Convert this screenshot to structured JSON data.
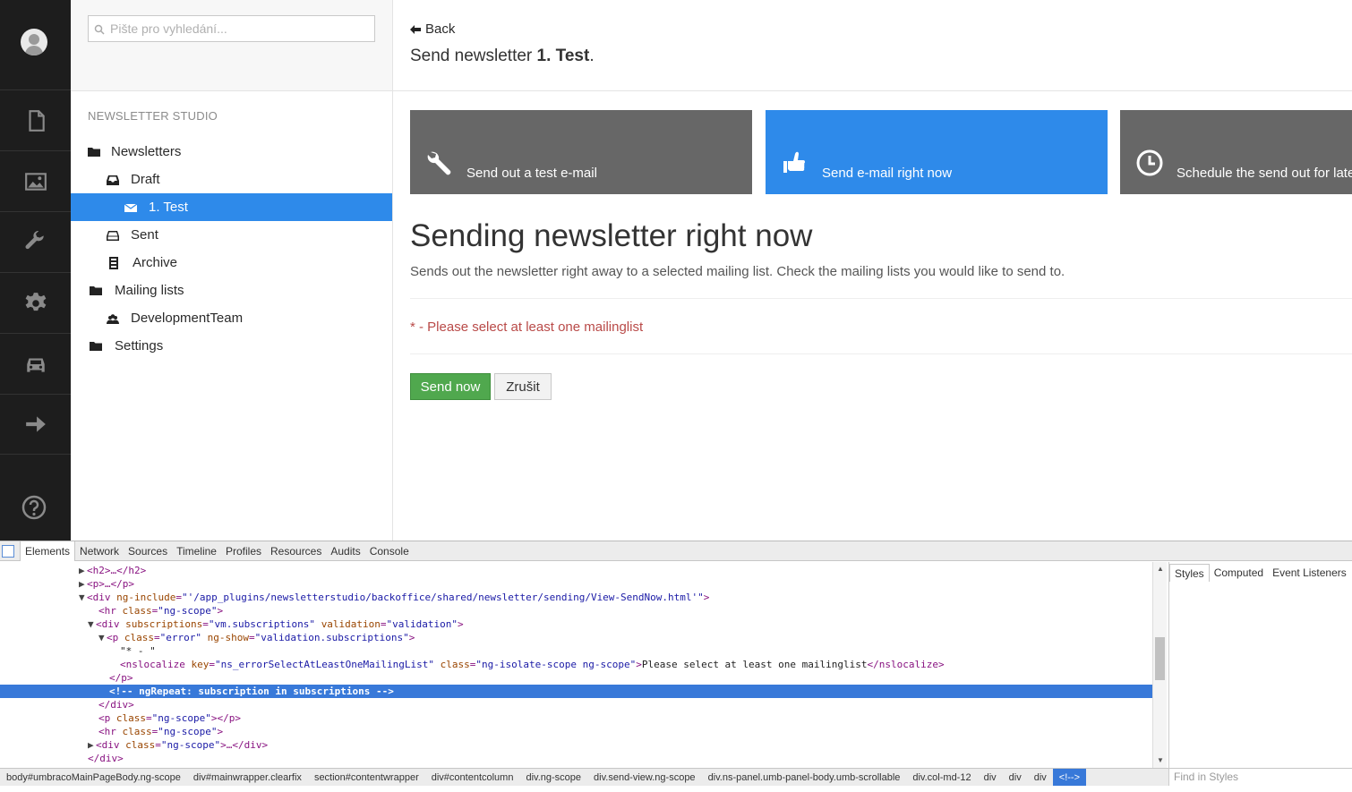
{
  "search": {
    "placeholder": "Pište pro vyhledání..."
  },
  "tree": {
    "title": "NEWSLETTER STUDIO",
    "items": [
      {
        "label": "Newsletters",
        "icon": "folder-icon"
      },
      {
        "label": "Draft",
        "icon": "inbox-icon"
      },
      {
        "label": "1. Test",
        "icon": "envelope-icon",
        "selected": true
      },
      {
        "label": "Sent",
        "icon": "inbox-icon"
      },
      {
        "label": "Archive",
        "icon": "archive-icon"
      },
      {
        "label": "Mailing lists",
        "icon": "folder-icon"
      },
      {
        "label": "DevelopmentTeam",
        "icon": "users-icon"
      },
      {
        "label": "Settings",
        "icon": "folder-icon"
      }
    ]
  },
  "header": {
    "back_label": "Back",
    "title_prefix": "Send newsletter",
    "title_name": "1. Test",
    "title_suffix": "."
  },
  "tiles": [
    {
      "label": "Send out a test e-mail",
      "icon": "wrench-icon"
    },
    {
      "label": "Send e-mail right now",
      "icon": "thumbs-up-icon"
    },
    {
      "label": "Schedule the send out for later",
      "icon": "clock-icon"
    }
  ],
  "content": {
    "heading": "Sending newsletter right now",
    "description": "Sends out the newsletter right away to a selected mailing list. Check the mailing lists you would like to send to.",
    "error": "* - Please select at least one mailinglist",
    "send_label": "Send now",
    "cancel_label": "Zrušit"
  },
  "devtools": {
    "tabs": [
      "Elements",
      "Network",
      "Sources",
      "Timeline",
      "Profiles",
      "Resources",
      "Audits",
      "Console"
    ],
    "side_tabs": [
      "Styles",
      "Computed",
      "Event Listeners"
    ],
    "find_placeholder": "Find in Styles",
    "breadcrumbs": [
      "body#umbracoMainPageBody.ng-scope",
      "div#mainwrapper.clearfix",
      "section#contentwrapper",
      "div#contentcolumn",
      "div.ng-scope",
      "div.send-view.ng-scope",
      "div.ns-panel.umb-panel-body.umb-scrollable",
      "div.col-md-12",
      "div",
      "div",
      "div",
      "<!-->"
    ],
    "code": {
      "l1_tag": "<h2>…</h2>",
      "l2_tag": "<p>…</p>",
      "l3_open": "<div ",
      "l3_attr": "ng-include",
      "l3_val": "\"'/app_plugins/newsletterstudio/backoffice/shared/newsletter/sending/View-SendNow.html'\"",
      "l3_close": ">",
      "l4_open": "<hr ",
      "l4_attr": "class",
      "l4_val": "\"ng-scope\"",
      "l4_close": ">",
      "l5_open": "<div ",
      "l5_attr1": "subscriptions",
      "l5_val1": "\"vm.subscriptions\"",
      "l5_attr2": "validation",
      "l5_val2": "\"validation\"",
      "l5_close": ">",
      "l6_open": "<p ",
      "l6_attr1": "class",
      "l6_val1": "\"error\"",
      "l6_attr2": "ng-show",
      "l6_val2": "\"validation.subscriptions\"",
      "l6_close": ">",
      "l7_text": "\"* - \"",
      "l8_open": "<nslocalize ",
      "l8_attr1": "key",
      "l8_val1": "\"ns_errorSelectAtLeastOneMailingList\"",
      "l8_attr2": "class",
      "l8_val2": "\"ng-isolate-scope ng-scope\"",
      "l8_text": "Please select at least one mailinglist",
      "l8_end": "</nslocalize>",
      "l9_comment": "<!-- ngRepeat: subscription in subscriptions -->",
      "l10_tag": "</p>",
      "l11_tag": "</div>",
      "l12_open": "<p ",
      "l12_attr": "class",
      "l12_val": "\"ng-scope\"",
      "l12_close": "></p>",
      "l13_open": "<hr ",
      "l13_attr": "class",
      "l13_val": "\"ng-scope\"",
      "l13_close": ">",
      "l14_open": "<div ",
      "l14_attr": "class",
      "l14_val": "\"ng-scope\"",
      "l14_close": ">…</div>",
      "l15_tag": "</div>"
    }
  }
}
